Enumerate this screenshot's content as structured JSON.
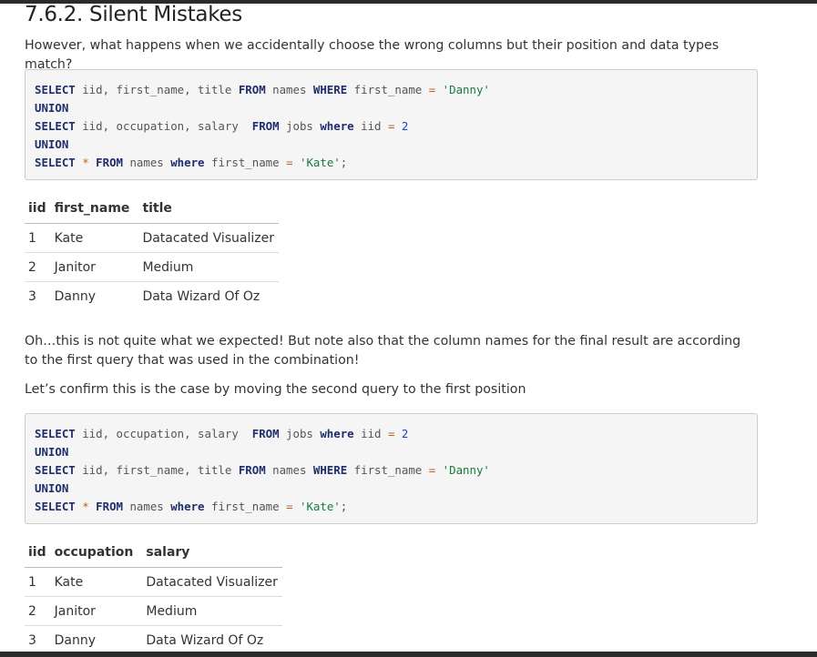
{
  "section": {
    "title": "7.6.2. Silent Mistakes",
    "intro": "However, what happens when we accidentally choose the wrong columns but their position and data types match?",
    "observation": "Oh…this is not quite what we expected! But note also that the column names for the final result are according to the first query that was used in the combination!",
    "confirm": "Let’s confirm this is the case by moving the second query to the first position"
  },
  "code1": {
    "l1": {
      "k1": "SELECT",
      "t1": " iid, first_name, title ",
      "k2": "FROM",
      "t2": " names ",
      "k3": "WHERE",
      "t3": " first_name ",
      "op": "=",
      "s": " 'Danny'"
    },
    "l2": {
      "k1": "UNION"
    },
    "l3": {
      "k1": "SELECT",
      "t1": " iid, occupation, salary  ",
      "k2": "FROM",
      "t2": " jobs ",
      "k3": "where",
      "t3": " iid ",
      "op": "=",
      "n": " 2"
    },
    "l4": {
      "k1": "UNION"
    },
    "l5": {
      "k1": "SELECT",
      "op1": " *",
      "k2": " FROM",
      "t2": " names ",
      "k3": "where",
      "t3": " first_name ",
      "op": "=",
      "s": " 'Kate'",
      "end": ";"
    }
  },
  "table1": {
    "headers": [
      "iid",
      "first_name",
      "title"
    ],
    "rows": [
      [
        "1",
        "Kate",
        "Datacated Visualizer"
      ],
      [
        "2",
        "Janitor",
        "Medium"
      ],
      [
        "3",
        "Danny",
        "Data Wizard Of Oz"
      ]
    ]
  },
  "code2": {
    "l1": {
      "k1": "SELECT",
      "t1": " iid, occupation, salary  ",
      "k2": "FROM",
      "t2": " jobs ",
      "k3": "where",
      "t3": " iid ",
      "op": "=",
      "n": " 2"
    },
    "l2": {
      "k1": "UNION"
    },
    "l3": {
      "k1": "SELECT",
      "t1": " iid, first_name, title ",
      "k2": "FROM",
      "t2": " names ",
      "k3": "WHERE",
      "t3": " first_name ",
      "op": "=",
      "s": " 'Danny'"
    },
    "l4": {
      "k1": "UNION"
    },
    "l5": {
      "k1": "SELECT",
      "op1": " *",
      "k2": " FROM",
      "t2": " names ",
      "k3": "where",
      "t3": " first_name ",
      "op": "=",
      "s": " 'Kate'",
      "end": ";"
    }
  },
  "table2": {
    "headers": [
      "iid",
      "occupation",
      "salary"
    ],
    "rows": [
      [
        "1",
        "Kate",
        "Datacated Visualizer"
      ],
      [
        "2",
        "Janitor",
        "Medium"
      ],
      [
        "3",
        "Danny",
        "Data Wizard Of Oz"
      ]
    ]
  }
}
